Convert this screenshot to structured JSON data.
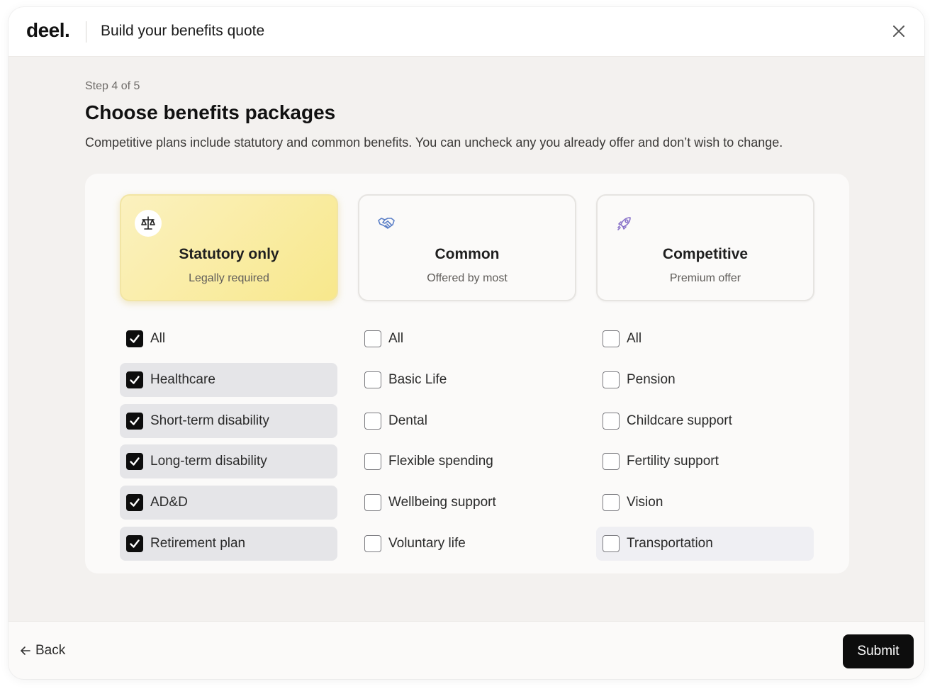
{
  "header": {
    "logo": "deel.",
    "title": "Build your benefits quote",
    "close_icon": "close-icon"
  },
  "step": "Step 4 of 5",
  "title": "Choose benefits packages",
  "description": "Competitive plans include statutory and common benefits. You can uncheck any you already offer and don’t wish to change.",
  "packages": [
    {
      "name": "Statutory only",
      "subtitle": "Legally required",
      "icon": "scales-icon",
      "selected": true,
      "options": [
        {
          "label": "All",
          "checked": true
        },
        {
          "label": "Healthcare",
          "checked": true
        },
        {
          "label": "Short-term disability",
          "checked": true
        },
        {
          "label": "Long-term disability",
          "checked": true
        },
        {
          "label": "AD&D",
          "checked": true
        },
        {
          "label": "Retirement plan",
          "checked": true
        }
      ]
    },
    {
      "name": "Common",
      "subtitle": "Offered by most",
      "icon": "handshake-icon",
      "selected": false,
      "options": [
        {
          "label": "All",
          "checked": false
        },
        {
          "label": "Basic Life",
          "checked": false
        },
        {
          "label": "Dental",
          "checked": false
        },
        {
          "label": "Flexible spending",
          "checked": false
        },
        {
          "label": "Wellbeing support",
          "checked": false
        },
        {
          "label": "Voluntary life",
          "checked": false
        }
      ]
    },
    {
      "name": "Competitive",
      "subtitle": "Premium offer",
      "icon": "rocket-icon",
      "selected": false,
      "options": [
        {
          "label": "All",
          "checked": false
        },
        {
          "label": "Pension",
          "checked": false
        },
        {
          "label": "Childcare support",
          "checked": false
        },
        {
          "label": "Fertility support",
          "checked": false
        },
        {
          "label": "Vision",
          "checked": false
        },
        {
          "label": "Transportation",
          "checked": false
        }
      ]
    }
  ],
  "footer": {
    "back_label": "Back",
    "submit_label": "Submit"
  },
  "colors": {
    "selected_card": "#f8e88c",
    "checkbox_checked": "#0d0d0d",
    "icon_blue": "#5b7fc7",
    "icon_purple": "#8a73c9"
  }
}
